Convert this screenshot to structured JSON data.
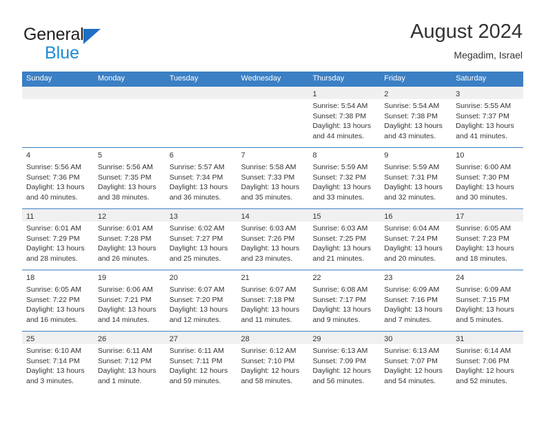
{
  "brand": {
    "name_part1": "General",
    "name_part2": "Blue",
    "logo_icon": "triangle-logo-icon"
  },
  "header": {
    "title": "August 2024",
    "location": "Megadim, Israel"
  },
  "colors": {
    "header_blue": "#3b7fc4",
    "brand_blue": "#1c8ad6",
    "logo_blue": "#1f6fc4",
    "row_shade": "#f0f0f0",
    "text": "#333333"
  },
  "weekdays": [
    "Sunday",
    "Monday",
    "Tuesday",
    "Wednesday",
    "Thursday",
    "Friday",
    "Saturday"
  ],
  "weeks": [
    {
      "shaded": true,
      "days": [
        {
          "num": "",
          "lines": []
        },
        {
          "num": "",
          "lines": []
        },
        {
          "num": "",
          "lines": []
        },
        {
          "num": "",
          "lines": []
        },
        {
          "num": "1",
          "lines": [
            "Sunrise: 5:54 AM",
            "Sunset: 7:38 PM",
            "Daylight: 13 hours",
            "and 44 minutes."
          ]
        },
        {
          "num": "2",
          "lines": [
            "Sunrise: 5:54 AM",
            "Sunset: 7:38 PM",
            "Daylight: 13 hours",
            "and 43 minutes."
          ]
        },
        {
          "num": "3",
          "lines": [
            "Sunrise: 5:55 AM",
            "Sunset: 7:37 PM",
            "Daylight: 13 hours",
            "and 41 minutes."
          ]
        }
      ]
    },
    {
      "shaded": false,
      "days": [
        {
          "num": "4",
          "lines": [
            "Sunrise: 5:56 AM",
            "Sunset: 7:36 PM",
            "Daylight: 13 hours",
            "and 40 minutes."
          ]
        },
        {
          "num": "5",
          "lines": [
            "Sunrise: 5:56 AM",
            "Sunset: 7:35 PM",
            "Daylight: 13 hours",
            "and 38 minutes."
          ]
        },
        {
          "num": "6",
          "lines": [
            "Sunrise: 5:57 AM",
            "Sunset: 7:34 PM",
            "Daylight: 13 hours",
            "and 36 minutes."
          ]
        },
        {
          "num": "7",
          "lines": [
            "Sunrise: 5:58 AM",
            "Sunset: 7:33 PM",
            "Daylight: 13 hours",
            "and 35 minutes."
          ]
        },
        {
          "num": "8",
          "lines": [
            "Sunrise: 5:59 AM",
            "Sunset: 7:32 PM",
            "Daylight: 13 hours",
            "and 33 minutes."
          ]
        },
        {
          "num": "9",
          "lines": [
            "Sunrise: 5:59 AM",
            "Sunset: 7:31 PM",
            "Daylight: 13 hours",
            "and 32 minutes."
          ]
        },
        {
          "num": "10",
          "lines": [
            "Sunrise: 6:00 AM",
            "Sunset: 7:30 PM",
            "Daylight: 13 hours",
            "and 30 minutes."
          ]
        }
      ]
    },
    {
      "shaded": true,
      "days": [
        {
          "num": "11",
          "lines": [
            "Sunrise: 6:01 AM",
            "Sunset: 7:29 PM",
            "Daylight: 13 hours",
            "and 28 minutes."
          ]
        },
        {
          "num": "12",
          "lines": [
            "Sunrise: 6:01 AM",
            "Sunset: 7:28 PM",
            "Daylight: 13 hours",
            "and 26 minutes."
          ]
        },
        {
          "num": "13",
          "lines": [
            "Sunrise: 6:02 AM",
            "Sunset: 7:27 PM",
            "Daylight: 13 hours",
            "and 25 minutes."
          ]
        },
        {
          "num": "14",
          "lines": [
            "Sunrise: 6:03 AM",
            "Sunset: 7:26 PM",
            "Daylight: 13 hours",
            "and 23 minutes."
          ]
        },
        {
          "num": "15",
          "lines": [
            "Sunrise: 6:03 AM",
            "Sunset: 7:25 PM",
            "Daylight: 13 hours",
            "and 21 minutes."
          ]
        },
        {
          "num": "16",
          "lines": [
            "Sunrise: 6:04 AM",
            "Sunset: 7:24 PM",
            "Daylight: 13 hours",
            "and 20 minutes."
          ]
        },
        {
          "num": "17",
          "lines": [
            "Sunrise: 6:05 AM",
            "Sunset: 7:23 PM",
            "Daylight: 13 hours",
            "and 18 minutes."
          ]
        }
      ]
    },
    {
      "shaded": false,
      "days": [
        {
          "num": "18",
          "lines": [
            "Sunrise: 6:05 AM",
            "Sunset: 7:22 PM",
            "Daylight: 13 hours",
            "and 16 minutes."
          ]
        },
        {
          "num": "19",
          "lines": [
            "Sunrise: 6:06 AM",
            "Sunset: 7:21 PM",
            "Daylight: 13 hours",
            "and 14 minutes."
          ]
        },
        {
          "num": "20",
          "lines": [
            "Sunrise: 6:07 AM",
            "Sunset: 7:20 PM",
            "Daylight: 13 hours",
            "and 12 minutes."
          ]
        },
        {
          "num": "21",
          "lines": [
            "Sunrise: 6:07 AM",
            "Sunset: 7:18 PM",
            "Daylight: 13 hours",
            "and 11 minutes."
          ]
        },
        {
          "num": "22",
          "lines": [
            "Sunrise: 6:08 AM",
            "Sunset: 7:17 PM",
            "Daylight: 13 hours",
            "and 9 minutes."
          ]
        },
        {
          "num": "23",
          "lines": [
            "Sunrise: 6:09 AM",
            "Sunset: 7:16 PM",
            "Daylight: 13 hours",
            "and 7 minutes."
          ]
        },
        {
          "num": "24",
          "lines": [
            "Sunrise: 6:09 AM",
            "Sunset: 7:15 PM",
            "Daylight: 13 hours",
            "and 5 minutes."
          ]
        }
      ]
    },
    {
      "shaded": true,
      "days": [
        {
          "num": "25",
          "lines": [
            "Sunrise: 6:10 AM",
            "Sunset: 7:14 PM",
            "Daylight: 13 hours",
            "and 3 minutes."
          ]
        },
        {
          "num": "26",
          "lines": [
            "Sunrise: 6:11 AM",
            "Sunset: 7:12 PM",
            "Daylight: 13 hours",
            "and 1 minute."
          ]
        },
        {
          "num": "27",
          "lines": [
            "Sunrise: 6:11 AM",
            "Sunset: 7:11 PM",
            "Daylight: 12 hours",
            "and 59 minutes."
          ]
        },
        {
          "num": "28",
          "lines": [
            "Sunrise: 6:12 AM",
            "Sunset: 7:10 PM",
            "Daylight: 12 hours",
            "and 58 minutes."
          ]
        },
        {
          "num": "29",
          "lines": [
            "Sunrise: 6:13 AM",
            "Sunset: 7:09 PM",
            "Daylight: 12 hours",
            "and 56 minutes."
          ]
        },
        {
          "num": "30",
          "lines": [
            "Sunrise: 6:13 AM",
            "Sunset: 7:07 PM",
            "Daylight: 12 hours",
            "and 54 minutes."
          ]
        },
        {
          "num": "31",
          "lines": [
            "Sunrise: 6:14 AM",
            "Sunset: 7:06 PM",
            "Daylight: 12 hours",
            "and 52 minutes."
          ]
        }
      ]
    }
  ]
}
